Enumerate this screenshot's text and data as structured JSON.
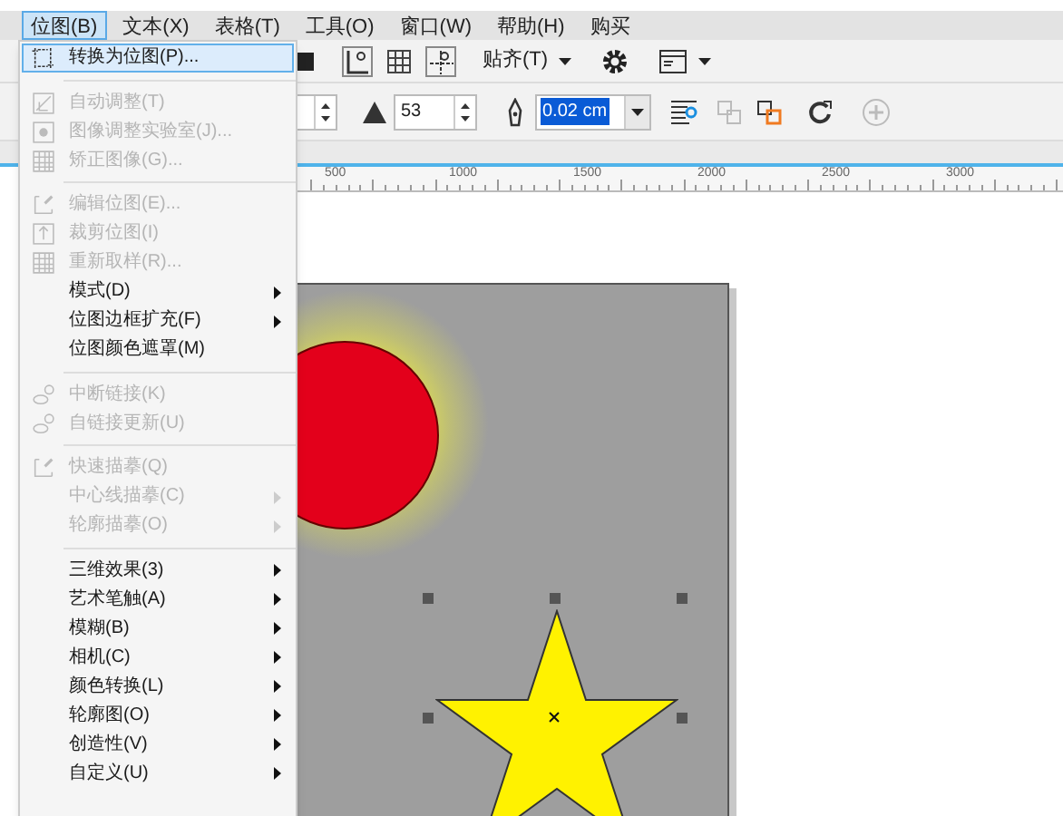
{
  "menubar": [
    {
      "label": "位图(B)",
      "selected": true
    },
    {
      "label": "文本(X)",
      "selected": false
    },
    {
      "label": "表格(T)",
      "selected": false
    },
    {
      "label": "工具(O)",
      "selected": false
    },
    {
      "label": "窗口(W)",
      "selected": false
    },
    {
      "label": "帮助(H)",
      "selected": false
    },
    {
      "label": "购买",
      "selected": false
    }
  ],
  "toolbar": {
    "snap_dropdown": "贴齐(T)",
    "field_value": "53",
    "outline_width": "0.02 cm"
  },
  "ruler": {
    "labels": [
      "500",
      "1000",
      "1500",
      "2000",
      "2500",
      "3000"
    ]
  },
  "bitmap_menu": [
    {
      "kind": "item",
      "label": "转换为位图(P)...",
      "disabled": false,
      "submenu": false,
      "selected": true
    },
    {
      "kind": "separator"
    },
    {
      "kind": "item",
      "label": "自动调整(T)",
      "disabled": true,
      "submenu": false,
      "selected": false
    },
    {
      "kind": "item",
      "label": "图像调整实验室(J)...",
      "disabled": true,
      "submenu": false,
      "selected": false
    },
    {
      "kind": "item",
      "label": "矫正图像(G)...",
      "disabled": true,
      "submenu": false,
      "selected": false
    },
    {
      "kind": "separator"
    },
    {
      "kind": "item",
      "label": "编辑位图(E)...",
      "disabled": true,
      "submenu": false,
      "selected": false
    },
    {
      "kind": "item",
      "label": "裁剪位图(I)",
      "disabled": true,
      "submenu": false,
      "selected": false
    },
    {
      "kind": "item",
      "label": "重新取样(R)...",
      "disabled": true,
      "submenu": false,
      "selected": false
    },
    {
      "kind": "item",
      "label": "模式(D)",
      "disabled": false,
      "submenu": true,
      "selected": false
    },
    {
      "kind": "item",
      "label": "位图边框扩充(F)",
      "disabled": false,
      "submenu": true,
      "selected": false
    },
    {
      "kind": "item",
      "label": "位图颜色遮罩(M)",
      "disabled": false,
      "submenu": false,
      "selected": false
    },
    {
      "kind": "separator"
    },
    {
      "kind": "item",
      "label": "中断链接(K)",
      "disabled": true,
      "submenu": false,
      "selected": false
    },
    {
      "kind": "item",
      "label": "自链接更新(U)",
      "disabled": true,
      "submenu": false,
      "selected": false
    },
    {
      "kind": "separator"
    },
    {
      "kind": "item",
      "label": "快速描摹(Q)",
      "disabled": true,
      "submenu": false,
      "selected": false
    },
    {
      "kind": "item",
      "label": "中心线描摹(C)",
      "disabled": true,
      "submenu": true,
      "selected": false
    },
    {
      "kind": "item",
      "label": "轮廓描摹(O)",
      "disabled": true,
      "submenu": true,
      "selected": false
    },
    {
      "kind": "separator"
    },
    {
      "kind": "item",
      "label": "三维效果(3)",
      "disabled": false,
      "submenu": true,
      "selected": false
    },
    {
      "kind": "item",
      "label": "艺术笔触(A)",
      "disabled": false,
      "submenu": true,
      "selected": false
    },
    {
      "kind": "item",
      "label": "模糊(B)",
      "disabled": false,
      "submenu": true,
      "selected": false
    },
    {
      "kind": "item",
      "label": "相机(C)",
      "disabled": false,
      "submenu": true,
      "selected": false
    },
    {
      "kind": "item",
      "label": "颜色转换(L)",
      "disabled": false,
      "submenu": true,
      "selected": false
    },
    {
      "kind": "item",
      "label": "轮廓图(O)",
      "disabled": false,
      "submenu": true,
      "selected": false
    },
    {
      "kind": "item",
      "label": "创造性(V)",
      "disabled": false,
      "submenu": true,
      "selected": false
    },
    {
      "kind": "item",
      "label": "自定义(U)",
      "disabled": false,
      "submenu": true,
      "selected": false
    }
  ]
}
